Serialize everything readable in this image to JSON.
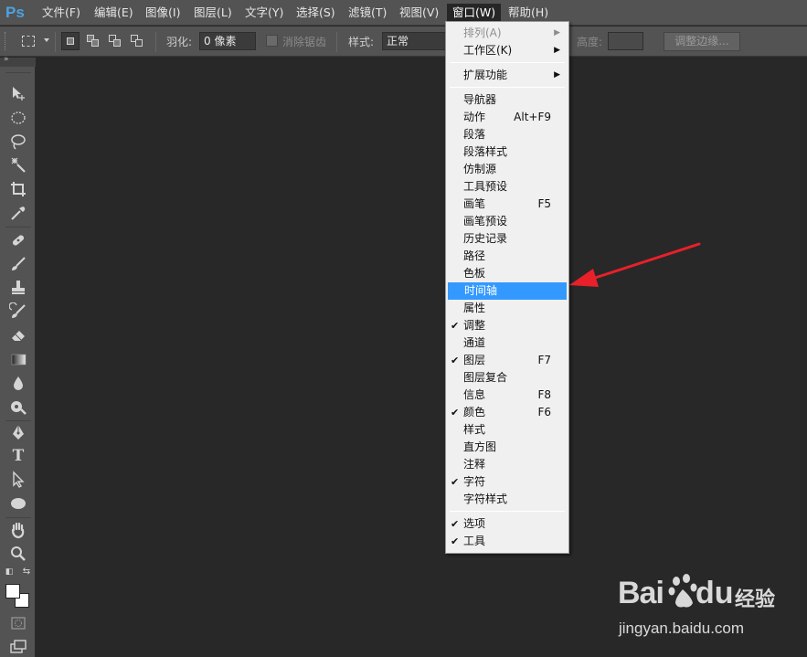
{
  "app": {
    "logo": "Ps"
  },
  "menubar": {
    "items": [
      {
        "label": "文件(F)"
      },
      {
        "label": "编辑(E)"
      },
      {
        "label": "图像(I)"
      },
      {
        "label": "图层(L)"
      },
      {
        "label": "文字(Y)"
      },
      {
        "label": "选择(S)"
      },
      {
        "label": "滤镜(T)"
      },
      {
        "label": "视图(V)"
      },
      {
        "label": "窗口(W)"
      },
      {
        "label": "帮助(H)"
      }
    ],
    "active_index": 8
  },
  "options": {
    "feather_label": "羽化:",
    "feather_value": "0 像素",
    "antialias_label": "消除锯齿",
    "style_label": "样式:",
    "style_value": "正常",
    "height_label": "高度:",
    "refine_button": "调整边缘..."
  },
  "window_menu": {
    "items": [
      {
        "label": "排列(A)",
        "submenu": true,
        "disabled": true
      },
      {
        "label": "工作区(K)",
        "submenu": true
      },
      {
        "label": "扩展功能",
        "submenu": true
      },
      {
        "label": "导航器"
      },
      {
        "label": "动作",
        "shortcut": "Alt+F9"
      },
      {
        "label": "段落"
      },
      {
        "label": "段落样式"
      },
      {
        "label": "仿制源"
      },
      {
        "label": "工具预设"
      },
      {
        "label": "画笔",
        "shortcut": "F5"
      },
      {
        "label": "画笔预设"
      },
      {
        "label": "历史记录"
      },
      {
        "label": "路径"
      },
      {
        "label": "色板"
      },
      {
        "label": "时间轴",
        "highlighted": true
      },
      {
        "label": "属性"
      },
      {
        "label": "调整",
        "checked": true
      },
      {
        "label": "通道"
      },
      {
        "label": "图层",
        "shortcut": "F7",
        "checked": true
      },
      {
        "label": "图层复合"
      },
      {
        "label": "信息",
        "shortcut": "F8"
      },
      {
        "label": "颜色",
        "shortcut": "F6",
        "checked": true
      },
      {
        "label": "样式"
      },
      {
        "label": "直方图"
      },
      {
        "label": "注释"
      },
      {
        "label": "字符",
        "checked": true
      },
      {
        "label": "字符样式"
      },
      {
        "label": "选项",
        "checked": true
      },
      {
        "label": "工具",
        "checked": true
      }
    ],
    "check_glyph": "✔",
    "submenu_glyph": "▶"
  },
  "watermark": {
    "brand_bai": "Bai",
    "brand_du": "du",
    "brand_cn": "经验",
    "url": "jingyan.baidu.com"
  },
  "colors": {
    "chrome": "#535353",
    "canvas": "#282828",
    "highlight": "#3399ff",
    "annotation_arrow": "#e8202a"
  },
  "icons": {
    "tools": [
      "move-icon",
      "elliptical-marquee-icon",
      "lasso-icon",
      "magic-wand-icon",
      "crop-icon",
      "eyedropper-icon",
      "healing-brush-icon",
      "brush-icon",
      "clone-stamp-icon",
      "history-brush-icon",
      "eraser-icon",
      "gradient-icon",
      "blur-icon",
      "dodge-icon",
      "pen-icon",
      "type-icon",
      "path-selection-icon",
      "ellipse-shape-icon",
      "hand-icon",
      "zoom-icon"
    ]
  }
}
